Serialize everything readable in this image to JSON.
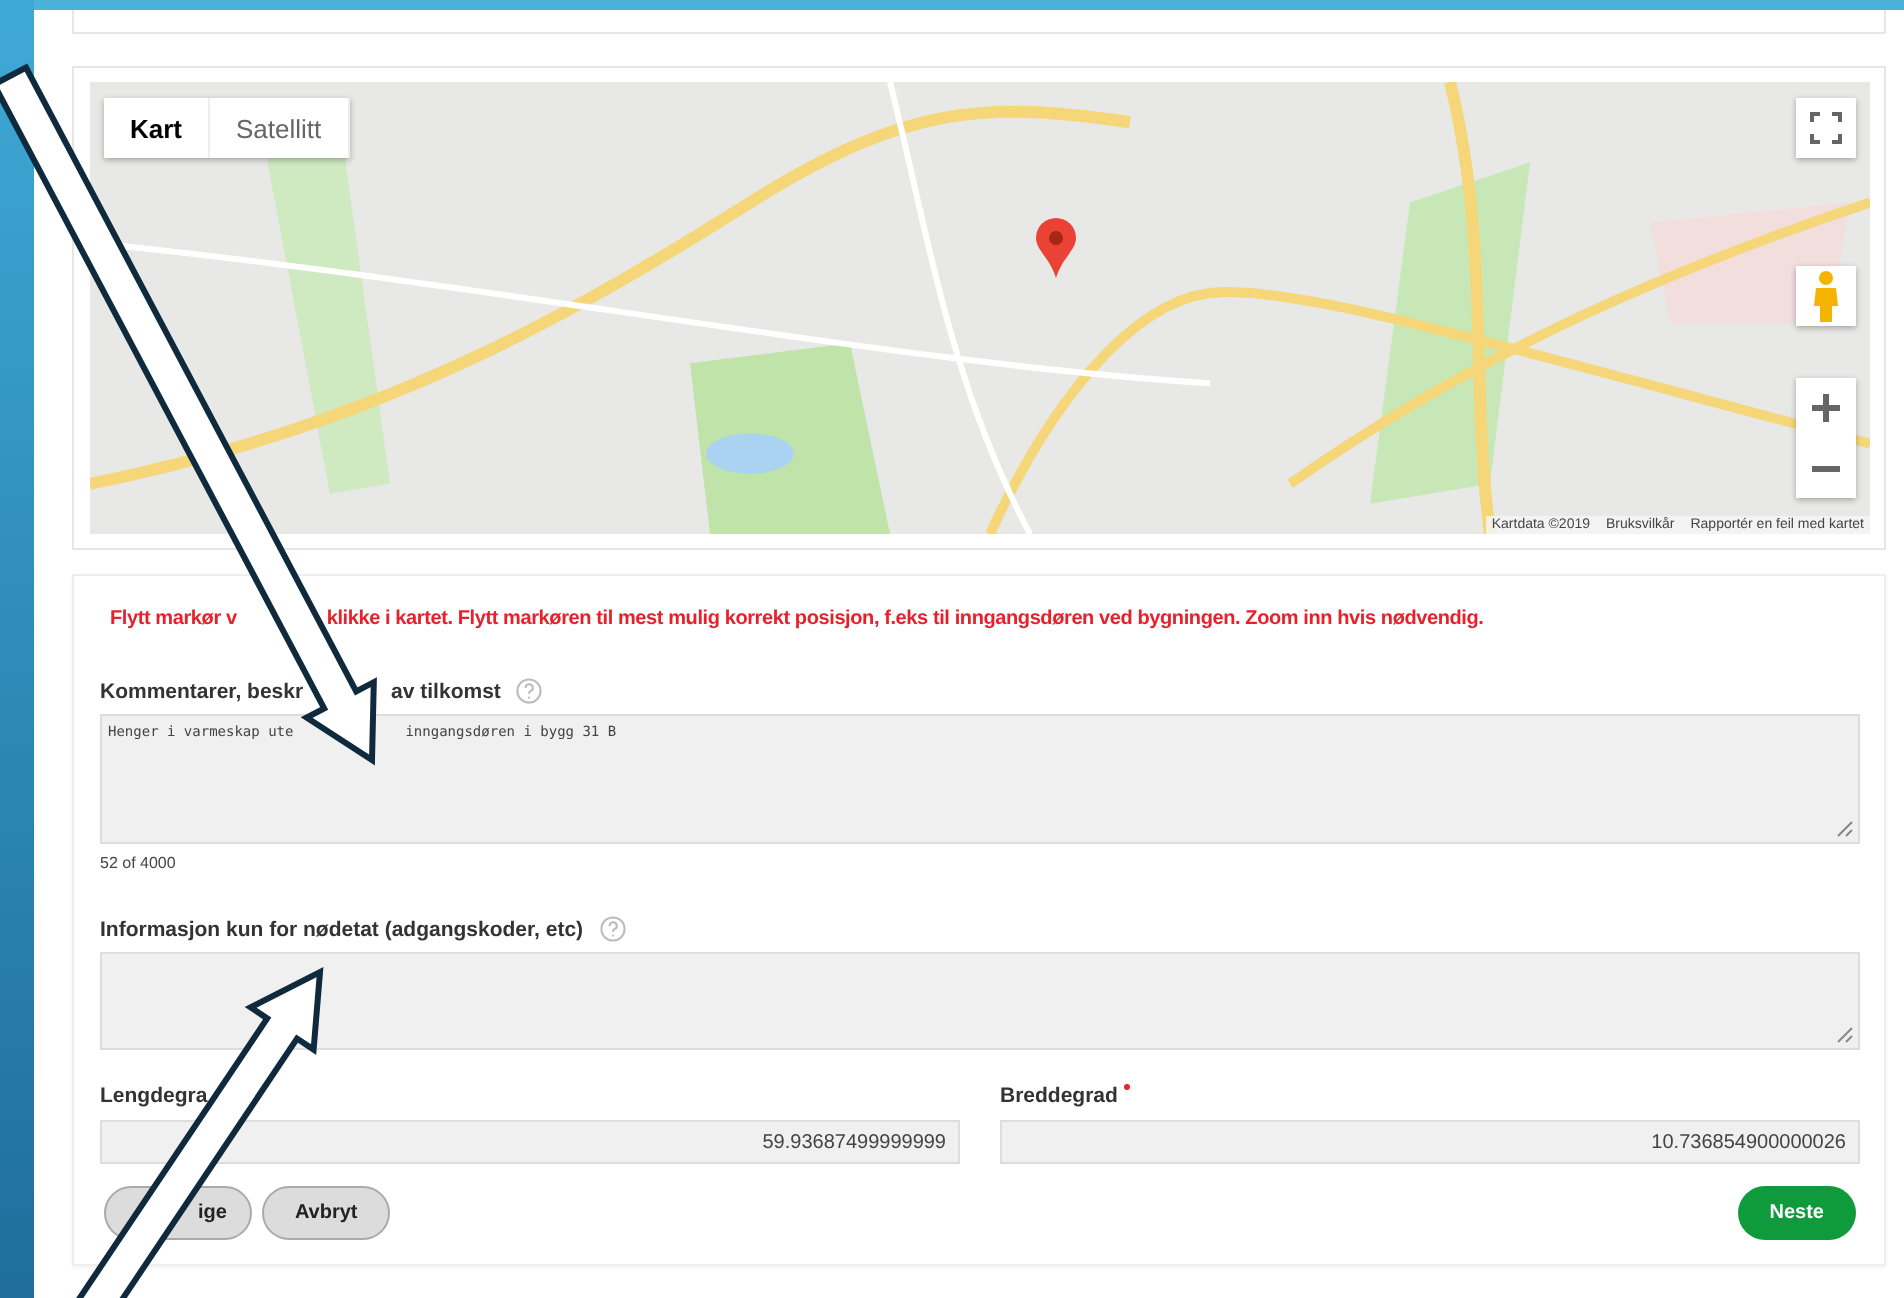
{
  "map": {
    "map_types": [
      {
        "label": "Kart",
        "selected": true
      },
      {
        "label": "Satellitt",
        "selected": false
      }
    ],
    "attribution": [
      "Kartdata ©2019",
      "Bruksvilkår",
      "Rapportér en feil med kartet"
    ]
  },
  "form": {
    "notice_parts": [
      "Flytt markør v",
      "klikke i kartet. Flytt markøren til mest mulig korrekt posisjon, f.eks til inngangsdøren ved bygningen. Zoom inn hvis nødvendig."
    ],
    "comment": {
      "label_parts": [
        "Kommentarer, beskr",
        "av tilkomst"
      ],
      "value_parts": [
        "Henger i varmeskap ute",
        "inngangsdøren i bygg 31 B"
      ],
      "counter": "52 of 4000"
    },
    "emergency": {
      "label": "Informasjon kun for nødetat (adgangskoder, etc)"
    },
    "longitude": {
      "label": "Lengdegra",
      "required": false,
      "value": "59.93687499999999"
    },
    "latitude": {
      "label": "Breddegrad",
      "required": true,
      "value": "10.736854900000026"
    },
    "buttons": [
      {
        "label": "ige",
        "kind": "secondary"
      },
      {
        "label": "Avbryt",
        "kind": "secondary"
      },
      {
        "label": "Neste",
        "kind": "primary"
      }
    ]
  }
}
